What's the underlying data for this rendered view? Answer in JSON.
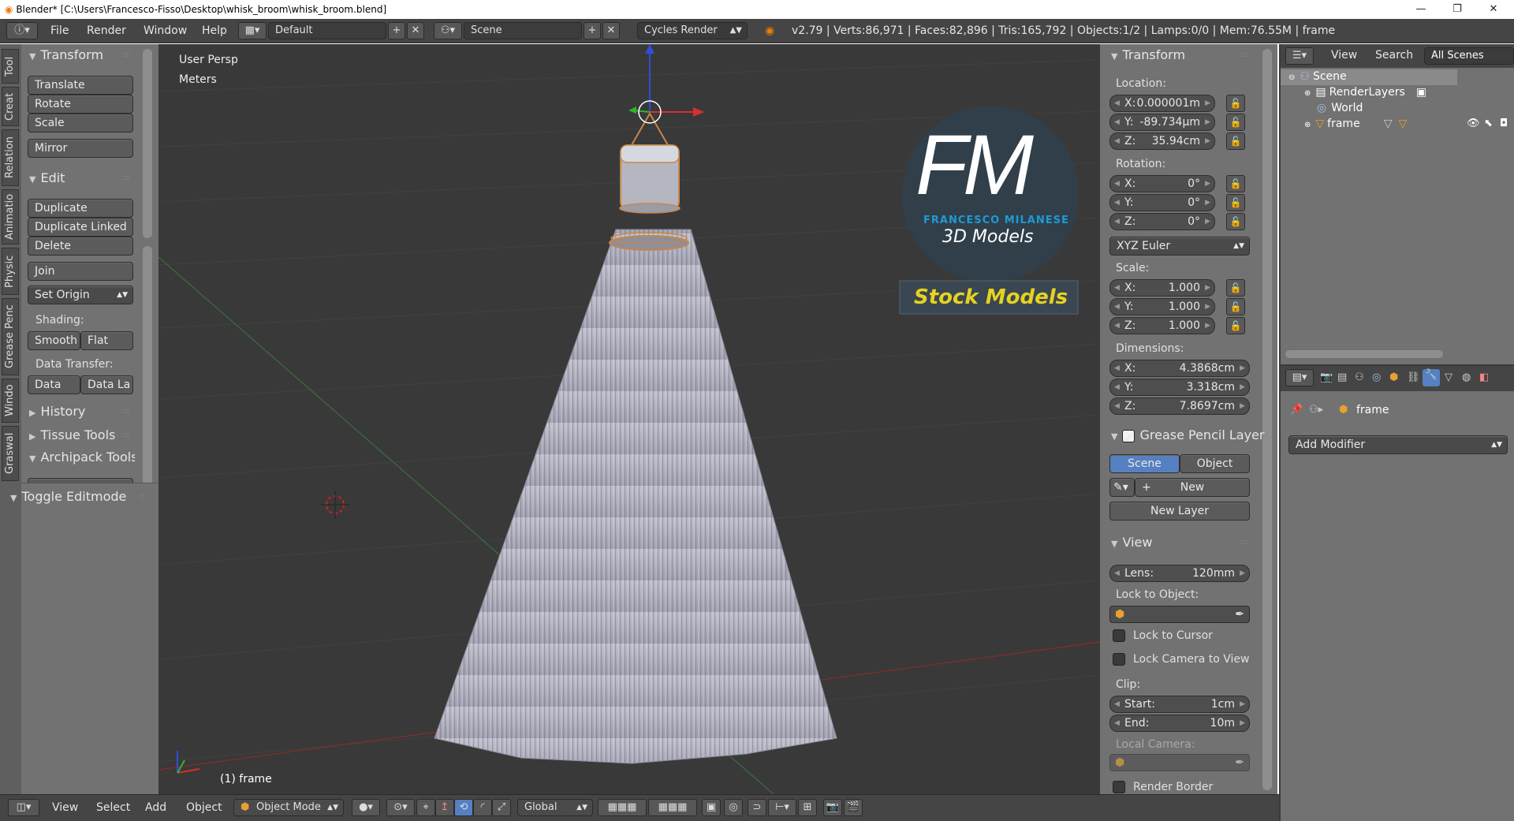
{
  "window": {
    "title": "Blender* [C:\\Users\\Francesco-Fisso\\Desktop\\whisk_broom\\whisk_broom.blend]"
  },
  "infobar": {
    "menus": [
      "File",
      "Render",
      "Window",
      "Help"
    ],
    "layout": "Default",
    "scene": "Scene",
    "engine": "Cycles Render",
    "stats": "v2.79 | Verts:86,971 | Faces:82,896 | Tris:165,792 | Objects:1/2 | Lamps:0/0 | Mem:76.55M | frame"
  },
  "toolshelf": {
    "tabs": [
      "Tool",
      "Creat",
      "Relation",
      "Animatio",
      "Physic",
      "Grease Penc",
      "Windo",
      "Graswal"
    ],
    "transform": {
      "header": "Transform",
      "buttons": [
        "Translate",
        "Rotate",
        "Scale",
        "Mirror"
      ]
    },
    "edit": {
      "header": "Edit",
      "buttons": [
        "Duplicate",
        "Duplicate Linked",
        "Delete",
        "Join"
      ],
      "set_origin": "Set Origin",
      "shading_label": "Shading:",
      "smooth": "Smooth",
      "flat": "Flat",
      "data_transfer_label": "Data Transfer:",
      "data": "Data",
      "data_la": "Data La"
    },
    "collapsed": [
      "History",
      "Tissue Tools",
      "Archipack Tools"
    ],
    "operator": "Toggle Editmode"
  },
  "viewport": {
    "view_name": "User Persp",
    "units": "Meters",
    "object_label": "(1) frame",
    "watermark": {
      "initials": "FM",
      "name": "FRANCESCO MILANESE",
      "subtitle": "3D Models",
      "stock": "Stock Models"
    }
  },
  "properties_panel": {
    "transform_header": "Transform",
    "location_label": "Location:",
    "location": [
      {
        "k": "X:",
        "v": "0.000001m"
      },
      {
        "k": "Y:",
        "v": "-89.734µm"
      },
      {
        "k": "Z:",
        "v": "35.94cm"
      }
    ],
    "rotation_label": "Rotation:",
    "rotation": [
      {
        "k": "X:",
        "v": "0°"
      },
      {
        "k": "Y:",
        "v": "0°"
      },
      {
        "k": "Z:",
        "v": "0°"
      }
    ],
    "rotation_mode": "XYZ Euler",
    "scale_label": "Scale:",
    "scale": [
      {
        "k": "X:",
        "v": "1.000"
      },
      {
        "k": "Y:",
        "v": "1.000"
      },
      {
        "k": "Z:",
        "v": "1.000"
      }
    ],
    "dimensions_label": "Dimensions:",
    "dimensions": [
      {
        "k": "X:",
        "v": "4.3868cm"
      },
      {
        "k": "Y:",
        "v": "3.318cm"
      },
      {
        "k": "Z:",
        "v": "7.8697cm"
      }
    ],
    "grease_header": "Grease Pencil Layer",
    "scene_btn": "Scene",
    "object_btn": "Object",
    "new_btn": "New",
    "new_layer_btn": "New Layer",
    "view_header": "View",
    "lens_k": "Lens:",
    "lens_v": "120mm",
    "lock_to_object": "Lock to Object:",
    "lock_cursor": "Lock to Cursor",
    "lock_camera": "Lock Camera to View",
    "clip_label": "Clip:",
    "clip_start_k": "Start:",
    "clip_start_v": "1cm",
    "clip_end_k": "End:",
    "clip_end_v": "10m",
    "local_camera": "Local Camera:",
    "render_border": "Render Border"
  },
  "outliner": {
    "menus": [
      "View",
      "Search"
    ],
    "filter": "All Scenes",
    "items": [
      {
        "label": "Scene"
      },
      {
        "label": "RenderLayers"
      },
      {
        "label": "World"
      },
      {
        "label": "frame"
      }
    ]
  },
  "properties_editor": {
    "breadcrumb": "frame",
    "add_modifier": "Add Modifier"
  },
  "bottombar": {
    "menus": [
      "View",
      "Select",
      "Add",
      "Object"
    ],
    "mode": "Object Mode",
    "orientation": "Global"
  },
  "colors": {
    "accent": "#5680c2",
    "header": "#454545",
    "panel": "#727272",
    "viewport": "#393939",
    "stock_yellow": "#e6d21f",
    "logo_blue": "#1e9ad6"
  }
}
